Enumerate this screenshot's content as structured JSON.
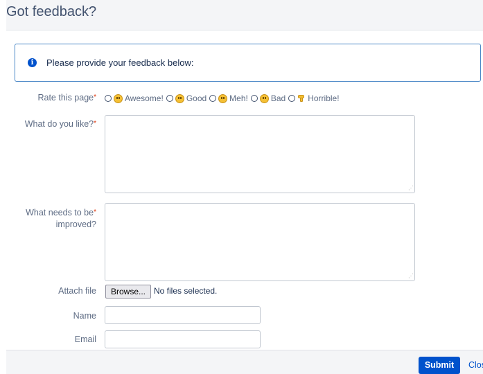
{
  "header": {
    "title": "Got feedback?"
  },
  "info": {
    "message": "Please provide your feedback below:"
  },
  "rating": {
    "label": "Rate this page",
    "required_mark": "*",
    "options": [
      {
        "label": "Awesome!",
        "icon": "grinning-face-icon"
      },
      {
        "label": "Good",
        "icon": "smiling-face-icon"
      },
      {
        "label": "Meh!",
        "icon": "neutral-face-icon"
      },
      {
        "label": "Bad",
        "icon": "frowning-face-icon"
      },
      {
        "label": "Horrible!",
        "icon": "thumbs-down-icon"
      }
    ]
  },
  "likes": {
    "label": "What do you like?",
    "required_mark": "*",
    "value": ""
  },
  "improve": {
    "label_line1": "What needs to be",
    "label_line2": "improved?",
    "required_mark": "*",
    "value": ""
  },
  "attach": {
    "label": "Attach file",
    "button": "Browse...",
    "status": "No files selected."
  },
  "name": {
    "label": "Name",
    "value": ""
  },
  "email": {
    "label": "Email",
    "value": ""
  },
  "footer": {
    "submit": "Submit",
    "close": "Clos"
  },
  "colors": {
    "primary": "#0052cc",
    "required": "#de350b",
    "info_border": "#4a87c6"
  }
}
